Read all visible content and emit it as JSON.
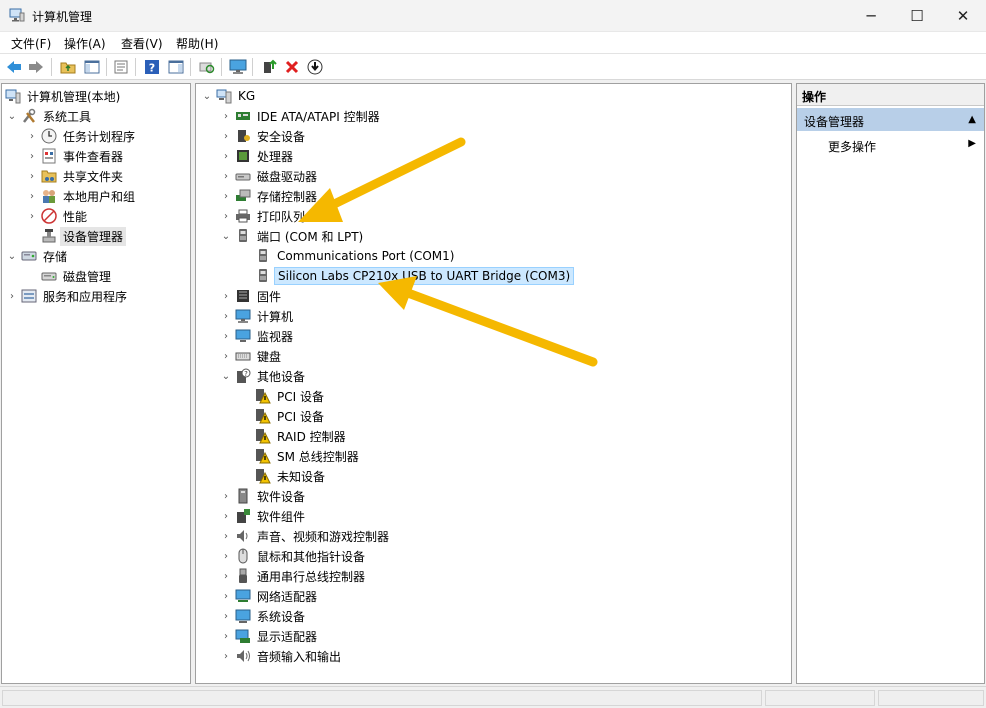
{
  "window": {
    "title": "计算机管理",
    "icon": "computer-management-icon",
    "controls": {
      "minimize": "─",
      "maximize": "☐",
      "close": "✕"
    }
  },
  "menu": [
    {
      "label": "文件(F)"
    },
    {
      "label": "操作(A)"
    },
    {
      "label": "查看(V)"
    },
    {
      "label": "帮助(H)"
    }
  ],
  "toolbar": [
    "back-icon",
    "forward-icon",
    "up-folder-icon",
    "show-hide-tree-icon",
    "properties-icon",
    "help-icon",
    "show-hide-action-pane-icon",
    "scan-hardware-icon",
    "monitor-icon",
    "update-driver-icon",
    "uninstall-icon",
    "disable-device-icon"
  ],
  "left_tree": [
    {
      "label": "计算机管理(本地)",
      "icon": "computer-management-icon"
    },
    {
      "label": "系统工具",
      "icon": "tools-icon"
    },
    {
      "label": "任务计划程序",
      "icon": "clock-icon"
    },
    {
      "label": "事件查看器",
      "icon": "event-viewer-icon"
    },
    {
      "label": "共享文件夹",
      "icon": "shared-folder-icon"
    },
    {
      "label": "本地用户和组",
      "icon": "users-icon"
    },
    {
      "label": "性能",
      "icon": "performance-icon"
    },
    {
      "label": "设备管理器",
      "icon": "device-manager-icon",
      "selected": true
    },
    {
      "label": "存储",
      "icon": "storage-icon"
    },
    {
      "label": "磁盘管理",
      "icon": "disk-icon"
    },
    {
      "label": "服务和应用程序",
      "icon": "services-icon"
    }
  ],
  "device_tree": [
    {
      "label": "KG",
      "icon": "computer-icon"
    },
    {
      "label": "IDE ATA/ATAPI 控制器",
      "icon": "ide-controller-icon"
    },
    {
      "label": "安全设备",
      "icon": "security-device-icon"
    },
    {
      "label": "处理器",
      "icon": "processor-icon"
    },
    {
      "label": "磁盘驱动器",
      "icon": "disk-drive-icon"
    },
    {
      "label": "存储控制器",
      "icon": "storage-controller-icon"
    },
    {
      "label": "打印队列",
      "icon": "printer-icon"
    },
    {
      "label": "端口 (COM 和 LPT)",
      "icon": "port-icon"
    },
    {
      "label": "Communications Port (COM1)",
      "icon": "port-icon"
    },
    {
      "label": "Silicon Labs CP210x USB to UART Bridge (COM3)",
      "icon": "port-icon",
      "selected": true
    },
    {
      "label": "固件",
      "icon": "firmware-icon"
    },
    {
      "label": "计算机",
      "icon": "computer-icon"
    },
    {
      "label": "监视器",
      "icon": "monitor-icon"
    },
    {
      "label": "键盘",
      "icon": "keyboard-icon"
    },
    {
      "label": "其他设备",
      "icon": "other-devices-icon"
    },
    {
      "label": "PCI 设备",
      "icon": "warning-device-icon"
    },
    {
      "label": "PCI 设备",
      "icon": "warning-device-icon"
    },
    {
      "label": "RAID 控制器",
      "icon": "warning-device-icon"
    },
    {
      "label": "SM 总线控制器",
      "icon": "warning-device-icon"
    },
    {
      "label": "未知设备",
      "icon": "warning-device-icon"
    },
    {
      "label": "软件设备",
      "icon": "software-device-icon"
    },
    {
      "label": "软件组件",
      "icon": "software-component-icon"
    },
    {
      "label": "声音、视频和游戏控制器",
      "icon": "sound-icon"
    },
    {
      "label": "鼠标和其他指针设备",
      "icon": "mouse-icon"
    },
    {
      "label": "通用串行总线控制器",
      "icon": "usb-icon"
    },
    {
      "label": "网络适配器",
      "icon": "network-adapter-icon"
    },
    {
      "label": "系统设备",
      "icon": "system-device-icon"
    },
    {
      "label": "显示适配器",
      "icon": "display-adapter-icon"
    },
    {
      "label": "音频输入和输出",
      "icon": "audio-icon"
    }
  ],
  "actions": {
    "header": "操作",
    "section": "设备管理器",
    "item": "更多操作"
  },
  "colors": {
    "highlight_arrow": "#f5b800",
    "selection_blue": "#cce8ff",
    "action_section": "#b8cfe8"
  }
}
